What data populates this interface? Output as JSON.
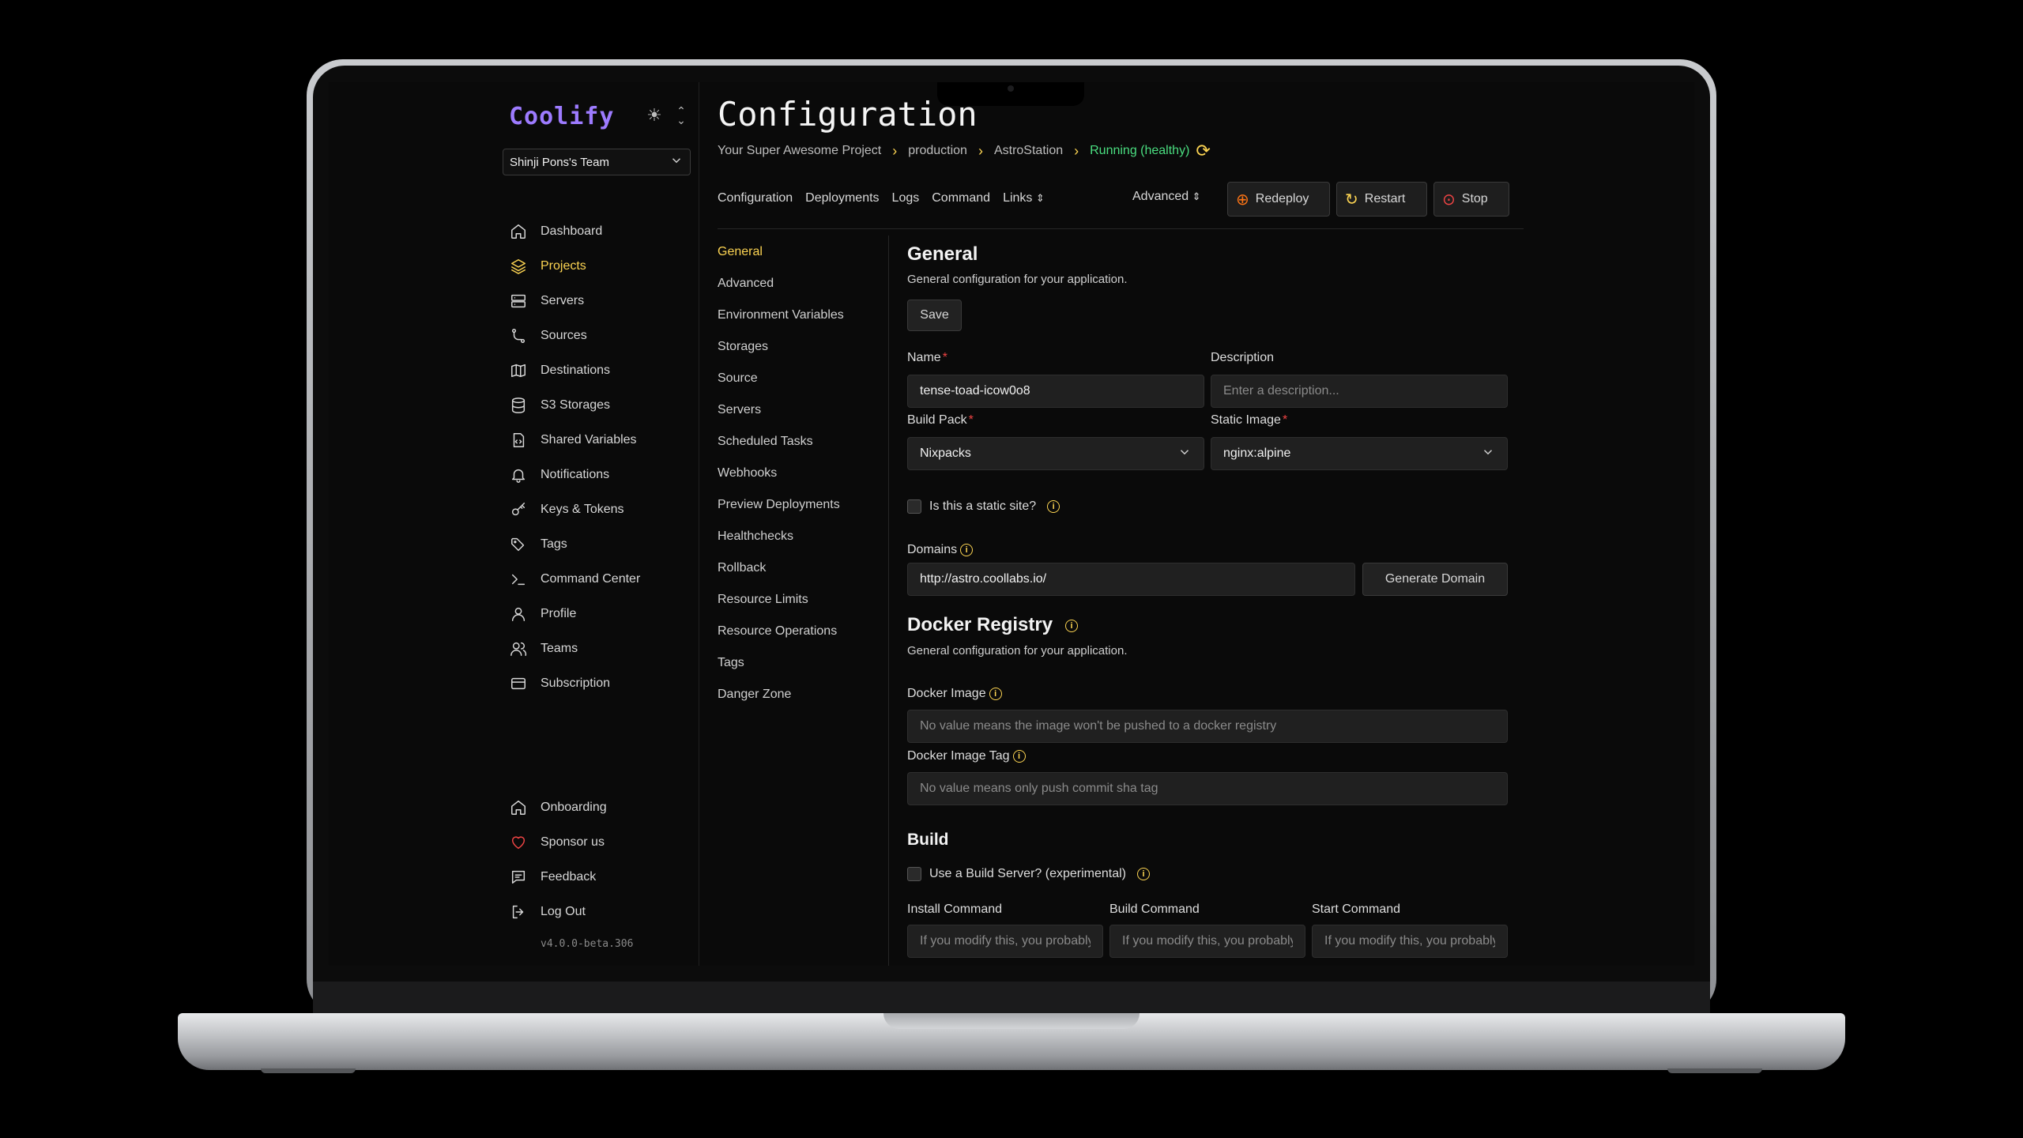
{
  "app": {
    "logo": "Coolify",
    "team": "Shinji Pons's Team",
    "version": "v4.0.0-beta.306"
  },
  "sidebar": {
    "items": [
      {
        "label": "Dashboard",
        "icon": "home-icon"
      },
      {
        "label": "Projects",
        "icon": "layers-icon",
        "active": true
      },
      {
        "label": "Servers",
        "icon": "server-icon"
      },
      {
        "label": "Sources",
        "icon": "git-branch-icon"
      },
      {
        "label": "Destinations",
        "icon": "map-icon"
      },
      {
        "label": "S3 Storages",
        "icon": "database-icon"
      },
      {
        "label": "Shared Variables",
        "icon": "file-code-icon"
      },
      {
        "label": "Notifications",
        "icon": "bell-icon"
      },
      {
        "label": "Keys & Tokens",
        "icon": "key-icon"
      },
      {
        "label": "Tags",
        "icon": "tags-icon"
      },
      {
        "label": "Command Center",
        "icon": "terminal-icon"
      },
      {
        "label": "Profile",
        "icon": "user-icon"
      },
      {
        "label": "Teams",
        "icon": "users-icon"
      },
      {
        "label": "Subscription",
        "icon": "credit-card-icon"
      }
    ],
    "bottom": [
      {
        "label": "Onboarding",
        "icon": "home-icon"
      },
      {
        "label": "Sponsor us",
        "icon": "heart-icon"
      },
      {
        "label": "Feedback",
        "icon": "message-icon"
      },
      {
        "label": "Log Out",
        "icon": "logout-icon"
      }
    ]
  },
  "header": {
    "title": "Configuration",
    "breadcrumbs": [
      "Your Super Awesome Project",
      "production",
      "AstroStation"
    ],
    "status": "Running (healthy)"
  },
  "tabs": [
    "Configuration",
    "Deployments",
    "Logs",
    "Command",
    "Links"
  ],
  "advanced_label": "Advanced",
  "actions": {
    "redeploy": "Redeploy",
    "restart": "Restart",
    "stop": "Stop"
  },
  "subnav": [
    "General",
    "Advanced",
    "Environment Variables",
    "Storages",
    "Source",
    "Servers",
    "Scheduled Tasks",
    "Webhooks",
    "Preview Deployments",
    "Healthchecks",
    "Rollback",
    "Resource Limits",
    "Resource Operations",
    "Tags",
    "Danger Zone"
  ],
  "general": {
    "title": "General",
    "description": "General configuration for your application.",
    "save": "Save",
    "name_label": "Name",
    "name_value": "tense-toad-icow0o8",
    "description_label": "Description",
    "description_placeholder": "Enter a description...",
    "build_pack_label": "Build Pack",
    "build_pack_value": "Nixpacks",
    "static_image_label": "Static Image",
    "static_image_value": "nginx:alpine",
    "static_site_label": "Is this a static site?",
    "domains_label": "Domains",
    "domains_value": "http://astro.coollabs.io/",
    "generate_domain": "Generate Domain"
  },
  "docker": {
    "title": "Docker Registry",
    "description": "General configuration for your application.",
    "image_label": "Docker Image",
    "image_placeholder": "No value means the image won't be pushed to a docker registry",
    "tag_label": "Docker Image Tag",
    "tag_placeholder": "No value means only push commit sha tag"
  },
  "build": {
    "title": "Build",
    "build_server_label": "Use a Build Server? (experimental)",
    "install_label": "Install Command",
    "build_label": "Build Command",
    "start_label": "Start Command",
    "command_placeholder": "If you modify this, you probably"
  },
  "colors": {
    "accent": "#fcd452",
    "logo": "#9d7bff",
    "running": "#4ade80",
    "danger": "#ef4444",
    "redeploy": "#f97316"
  }
}
